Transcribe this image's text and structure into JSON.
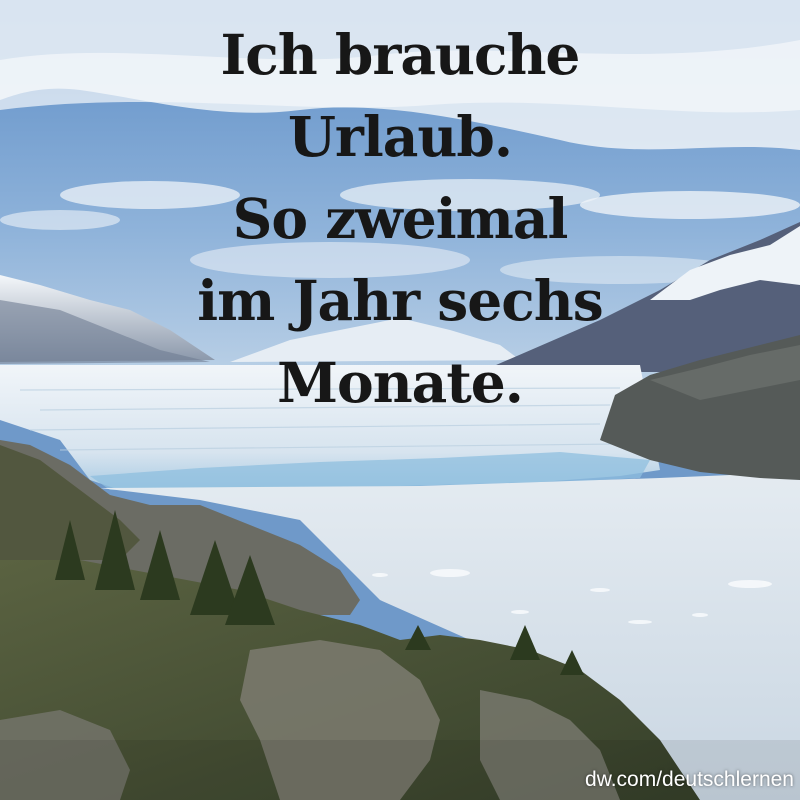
{
  "quote": {
    "lines": [
      "Ich brauche",
      "Urlaub.",
      "So zweimal",
      "im Jahr sechs",
      "Monate."
    ]
  },
  "credit": "dw.com/deutschlernen",
  "colors": {
    "text": "#171717",
    "sky": "#6f99c9",
    "cloud": "#eef3f8",
    "glacier": "#dfe9f1",
    "glacier_edge": "#8fbfdf",
    "lake": "#d7e1ea",
    "rock": "#5e5f5a",
    "vegetation": "#43512d"
  }
}
